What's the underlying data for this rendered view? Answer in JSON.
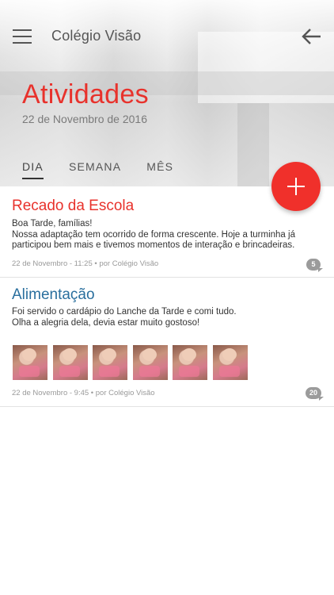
{
  "header": {
    "app_title": "Colégio Visão",
    "page_title": "Atividades",
    "date": "22 de Novembro de 2016"
  },
  "tabs": [
    {
      "label": "DIA",
      "active": true
    },
    {
      "label": "SEMANA",
      "active": false
    },
    {
      "label": "MÊS",
      "active": false
    }
  ],
  "colors": {
    "accent": "#e8322c",
    "link_title": "#2a6f9e",
    "badge": "#9b9b9b"
  },
  "icons": {
    "menu": "hamburger-icon",
    "back": "arrow-left-icon",
    "add": "plus-icon",
    "comments": "speech-bubble-icon"
  },
  "feed": [
    {
      "title": "Recado da Escola",
      "body": [
        "Boa Tarde, famílias!",
        "Nossa adaptação tem ocorrido de forma crescente. Hoje a turminha já",
        "participou bem mais e tivemos momentos de interação e brincadeiras."
      ],
      "meta": "22 de Novembro - 11:25 • por Colégio Visão",
      "comments": "5"
    },
    {
      "title": "Alimentação",
      "body": [
        "Foi servido o cardápio do Lanche da Tarde e comi tudo.",
        "Olha a alegria dela, devia estar muito gostoso!"
      ],
      "photo_count": 6,
      "meta": "22 de Novembro - 9:45 • por Colégio Visão",
      "comments": "20"
    }
  ]
}
